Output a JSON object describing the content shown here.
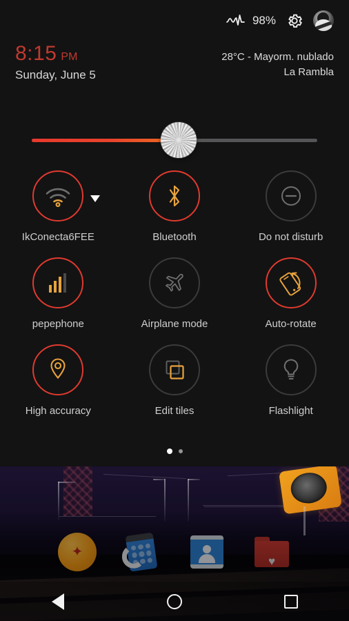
{
  "status_bar": {
    "battery_icon": "battery-waveform-icon",
    "battery_percent": "98%",
    "settings_icon": "gear-icon",
    "avatar_icon": "user-avatar"
  },
  "header": {
    "time": "8:15",
    "ampm": "PM",
    "date": "Sunday, June 5",
    "weather_main": "28°C - Mayorm. nublado",
    "weather_location": "La Rambla",
    "time_color": "#c0392f"
  },
  "brightness": {
    "label": "brightness-slider",
    "value_percent": 50,
    "fill_color": "#e8392c",
    "track_color": "#555456"
  },
  "tiles": [
    {
      "id": "wifi",
      "label": "IkConecta6FEE",
      "icon": "wifi-icon",
      "active": true,
      "has_caret": true
    },
    {
      "id": "bluetooth",
      "label": "Bluetooth",
      "icon": "bluetooth-icon",
      "active": true,
      "has_caret": false
    },
    {
      "id": "dnd",
      "label": "Do not disturb",
      "icon": "do-not-disturb-icon",
      "active": false,
      "has_caret": false
    },
    {
      "id": "carrier",
      "label": "pepephone",
      "icon": "signal-bars-icon",
      "active": true,
      "has_caret": false
    },
    {
      "id": "airplane",
      "label": "Airplane mode",
      "icon": "airplane-icon",
      "active": false,
      "has_caret": false
    },
    {
      "id": "autorotate",
      "label": "Auto-rotate",
      "icon": "auto-rotate-icon",
      "active": true,
      "has_caret": false
    },
    {
      "id": "location",
      "label": "High accuracy",
      "icon": "location-pin-icon",
      "active": true,
      "has_caret": false
    },
    {
      "id": "edit",
      "label": "Edit tiles",
      "icon": "edit-tiles-icon",
      "active": false,
      "has_caret": false
    },
    {
      "id": "flashlight",
      "label": "Flashlight",
      "icon": "flashlight-icon",
      "active": false,
      "has_caret": false
    }
  ],
  "pages": {
    "count": 2,
    "current": 1
  },
  "dock": [
    {
      "id": "dragonball",
      "icon": "dragon-ball-icon"
    },
    {
      "id": "phone",
      "icon": "phone-dialer-icon"
    },
    {
      "id": "contacts",
      "icon": "contacts-icon"
    },
    {
      "id": "files",
      "icon": "red-folder-heart-icon"
    }
  ],
  "navbar": [
    {
      "id": "back",
      "icon": "back-triangle-icon"
    },
    {
      "id": "home",
      "icon": "home-circle-icon"
    },
    {
      "id": "recent",
      "icon": "recents-square-icon"
    }
  ],
  "colors": {
    "active_ring": "#e03a2f",
    "inactive_ring": "#3b3b3b",
    "icon_amber": "#e8a33d",
    "icon_gray": "#6f6f6f",
    "panel_bg": "#131313"
  }
}
